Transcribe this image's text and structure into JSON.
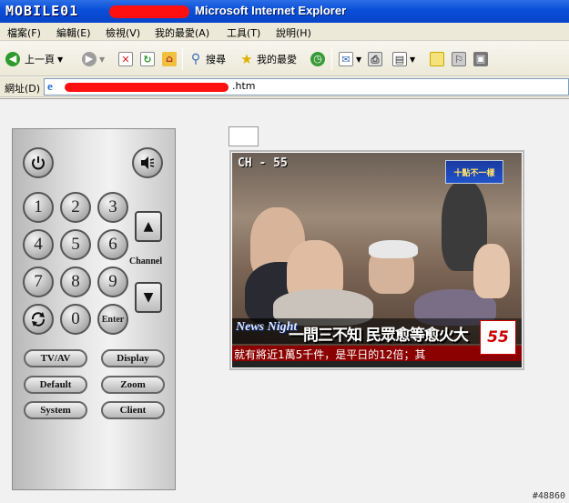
{
  "window": {
    "logo_text": "MOBILE01",
    "title": "Microsoft Internet Explorer"
  },
  "menubar": {
    "items": [
      "檔案(F)",
      "編輯(E)",
      "檢視(V)",
      "我的最愛(A)",
      "工具(T)",
      "說明(H)"
    ]
  },
  "toolbar": {
    "back_label": "上一頁",
    "search_label": "搜尋",
    "favorites_label": "我的最愛"
  },
  "addressbar": {
    "label": "網址(D)",
    "url_suffix": ".htm"
  },
  "remote": {
    "digits": [
      "1",
      "2",
      "3",
      "4",
      "5",
      "6",
      "7",
      "8",
      "9",
      "0"
    ],
    "enter_label": "Enter",
    "channel_label": "Channel",
    "up_symbol": "▲",
    "down_symbol": "▼",
    "buttons": [
      "TV/AV",
      "Display",
      "Default",
      "Zoom",
      "System",
      "Client"
    ]
  },
  "tv": {
    "channel_overlay": "CH - 55",
    "station_badge": "十點不一樣",
    "news_logo": "News Night",
    "headline": "一問三不知 民眾愈等愈火大",
    "ticker": "就有將近1萬5千件，是平日的12倍；其",
    "channel_logo": "55"
  },
  "watermark": "#48860",
  "colors": {
    "titlebar": "#0a4ed8",
    "redaction": "#ff1010",
    "ticker_bg": "#8b0000"
  }
}
